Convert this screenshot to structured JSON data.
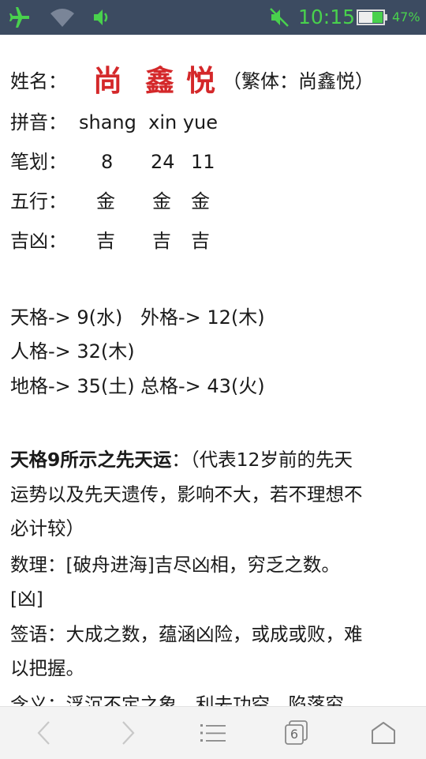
{
  "status_bar": {
    "time": "10:15",
    "battery_text": "47%",
    "accent": "#49d14d",
    "icons": [
      "airplane-icon",
      "wifi-icon",
      "volume-icon",
      "mute-icon",
      "battery-icon"
    ]
  },
  "profile": {
    "name_label": "姓名：",
    "name_chars": [
      "尚",
      "鑫",
      "悦"
    ],
    "traditional_note": "（繁体：尚鑫悦）",
    "pinyin_label": "拼音：",
    "pinyin": "shang  xin yue",
    "strokes_label": "笔划：",
    "strokes": [
      "8",
      "24",
      "11"
    ],
    "wuxing_label": "五行：",
    "wuxing": [
      "金",
      "金",
      "金"
    ],
    "jixiong_label": "吉凶：",
    "jixiong": [
      "吉",
      "吉",
      "吉"
    ]
  },
  "grids": {
    "tiange": "天格-> 9(水)",
    "waige": "外格-> 12(木)",
    "renge": "人格-> 32(木)",
    "dige": "地格-> 35(土)",
    "zongge": "总格-> 43(火)"
  },
  "analysis": {
    "heading": "天格9所示之先天运",
    "intro_line1": "：（代表12岁前的先天",
    "line2": "运势以及先天遗传，影响不大，若不理想不",
    "line3": "必计较）",
    "line4": "数理：[破舟进海]吉尽凶相，穷乏之数。",
    "line5": "[凶]",
    "line6": "签语：大成之数，蕴涵凶险，或成或败，难",
    "line7": "以把握。",
    "line8": "含义：浮沉不定之象，利去功空，陷落穷"
  },
  "bottom_nav": {
    "tab_count": "6"
  }
}
